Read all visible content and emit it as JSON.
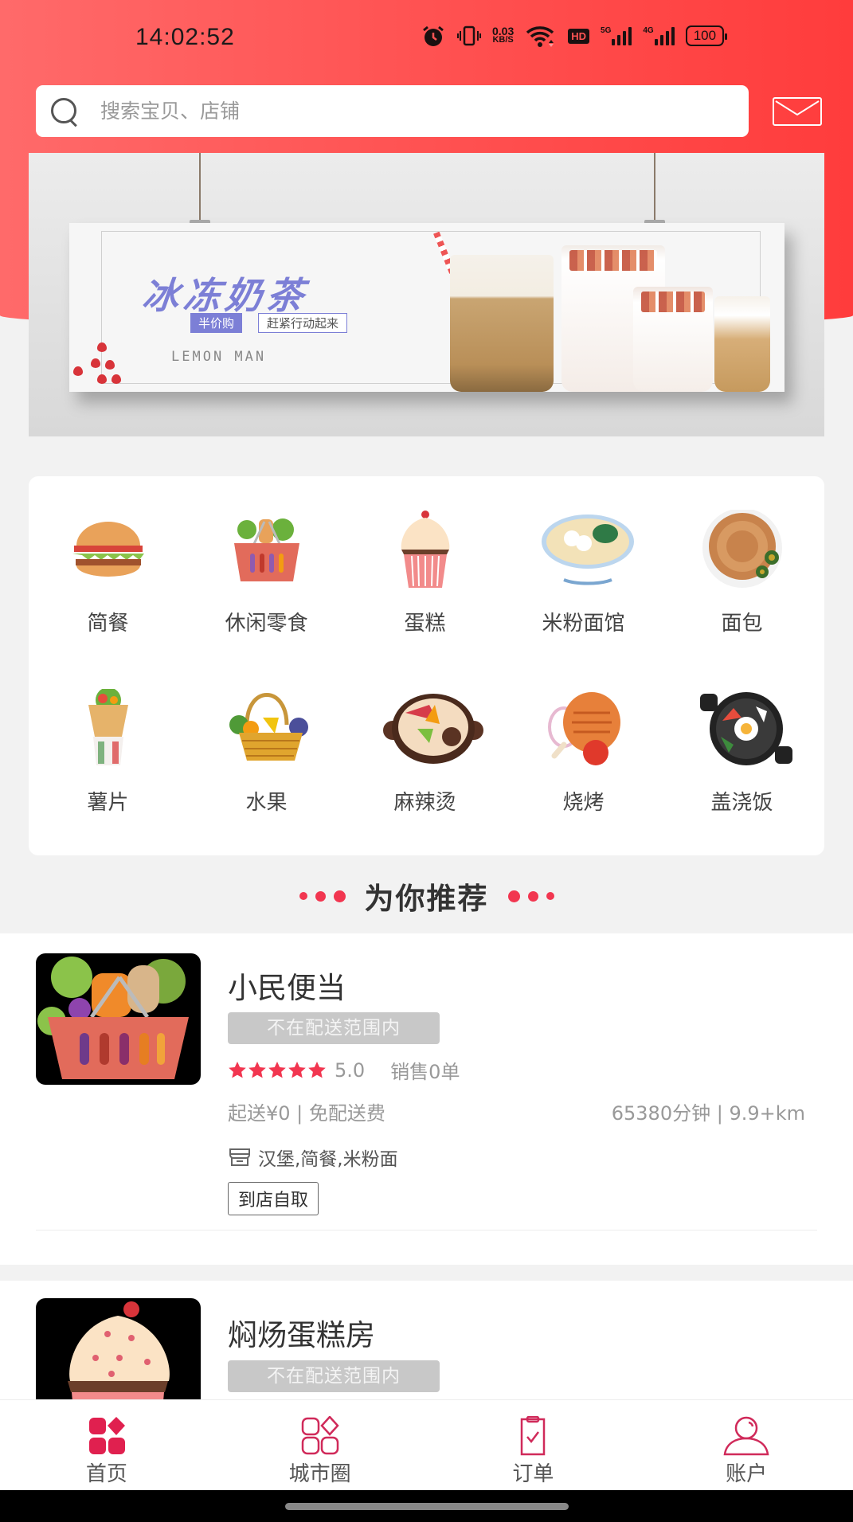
{
  "status_bar": {
    "time": "14:02:52",
    "net_speed_value": "0.03",
    "net_speed_unit": "KB/S",
    "hd_label": "HD",
    "sig1_label": "5G",
    "sig2_label": "4G",
    "battery": "100",
    "icons": [
      "alarm-icon",
      "vibrate-icon",
      "wifi-icon",
      "hd-voice-icon",
      "signal-5g-icon",
      "signal-4g-icon",
      "battery-icon"
    ]
  },
  "search": {
    "placeholder": "搜索宝贝、店铺",
    "value": "",
    "icon": "search-icon",
    "message_icon": "mail-icon"
  },
  "banner": {
    "title": "冰冻奶茶",
    "tag_primary": "半价购",
    "tag_secondary": "赶紧行动起来",
    "subtitle": "LEMON MAN"
  },
  "categories": [
    {
      "label": "简餐",
      "icon": "burger-icon"
    },
    {
      "label": "休闲零食",
      "icon": "snack-basket-icon"
    },
    {
      "label": "蛋糕",
      "icon": "cupcake-icon"
    },
    {
      "label": "米粉面馆",
      "icon": "noodle-bowl-icon"
    },
    {
      "label": "面包",
      "icon": "flatbread-icon"
    },
    {
      "label": "薯片",
      "icon": "wrap-icon"
    },
    {
      "label": "水果",
      "icon": "fruit-basket-icon"
    },
    {
      "label": "麻辣烫",
      "icon": "hotpot-icon"
    },
    {
      "label": "烧烤",
      "icon": "bbq-icon"
    },
    {
      "label": "盖浇饭",
      "icon": "rice-pan-icon"
    }
  ],
  "recommend": {
    "title": "为你推荐"
  },
  "shops": [
    {
      "name": "小民便当",
      "status_badge": "不在配送范围内",
      "rating": 5.0,
      "rating_text": "5.0",
      "stars": 5,
      "sales": "销售0单",
      "delivery": "起送¥0 | 免配送费",
      "eta_distance": "65380分钟 | 9.9+km",
      "cuisine": "汉堡,简餐,米粉面",
      "pickup_label": "到店自取"
    },
    {
      "name": "焖炀蛋糕房",
      "status_badge": "不在配送范围内"
    }
  ],
  "tabbar": [
    {
      "label": "首页",
      "icon": "home-grid-icon",
      "active": true
    },
    {
      "label": "城市圈",
      "icon": "city-circle-icon",
      "active": false
    },
    {
      "label": "订单",
      "icon": "order-clipboard-icon",
      "active": false
    },
    {
      "label": "账户",
      "icon": "account-user-icon",
      "active": false
    }
  ],
  "colors": {
    "brand_red": "#ff4f4f",
    "accent_pink": "#e0204f",
    "star_red": "#f23650",
    "badge_gray": "#c8c8c8"
  }
}
